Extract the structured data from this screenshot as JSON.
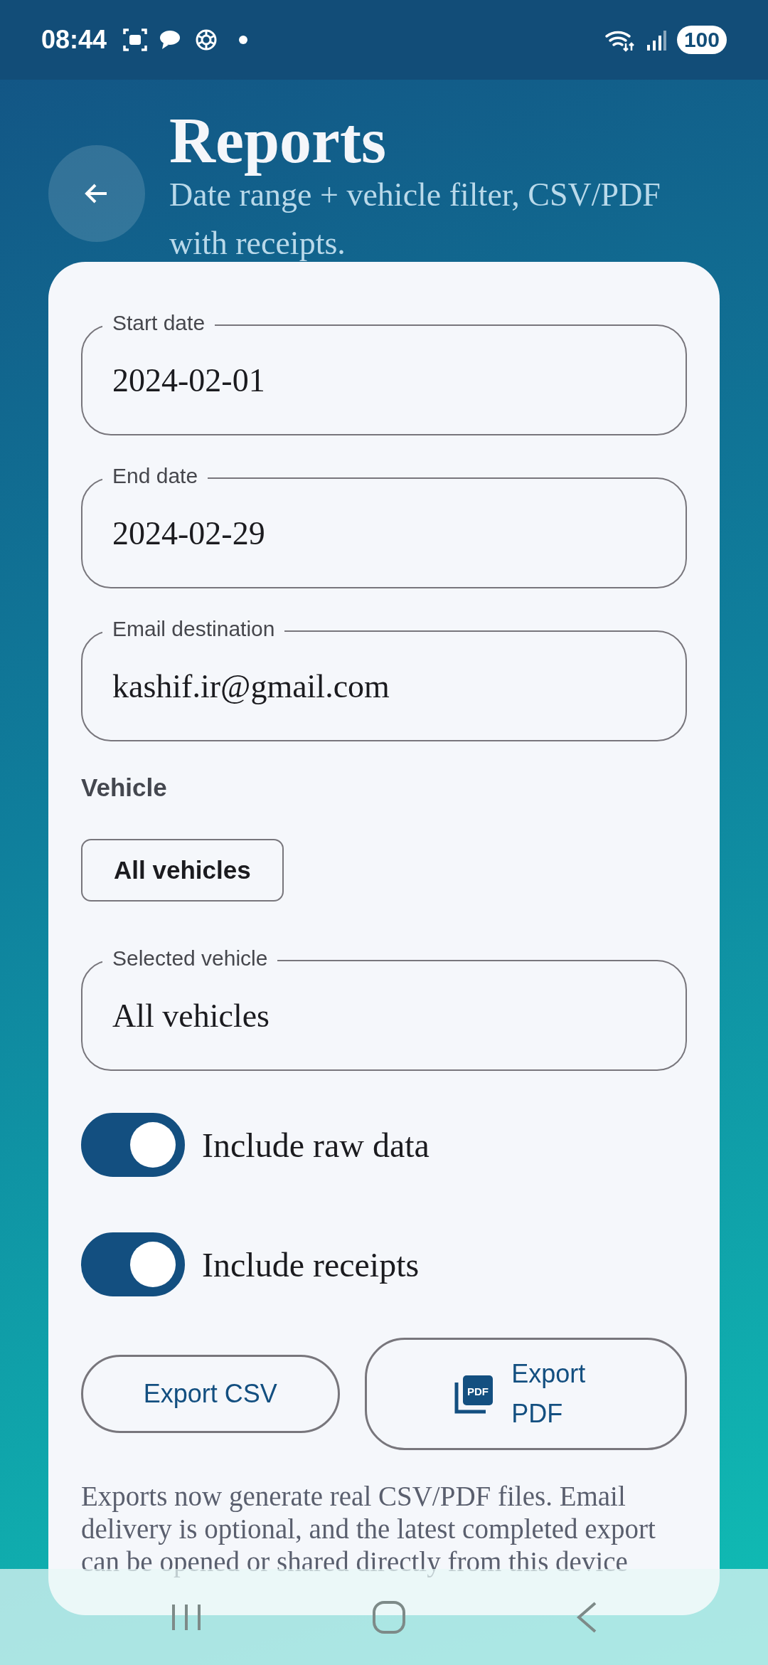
{
  "status_bar": {
    "time": "08:44",
    "battery": "100"
  },
  "header": {
    "title": "Reports",
    "subtitle": "Date range + vehicle filter, CSV/PDF with receipts."
  },
  "fields": [
    {
      "label": "Start date",
      "value": "2024-02-01"
    },
    {
      "label": "End date",
      "value": "2024-02-29"
    },
    {
      "label": "Email destination",
      "value": "kashif.ir@gmail.com"
    }
  ],
  "vehicle": {
    "heading": "Vehicle",
    "chips": [
      {
        "label": "All vehicles",
        "selected": false
      }
    ],
    "selected_field": {
      "label": "Selected vehicle",
      "value": "All vehicles"
    }
  },
  "toggles": [
    {
      "label": "Include raw data",
      "on": true
    },
    {
      "label": "Include receipts",
      "on": true
    }
  ],
  "buttons": [
    {
      "kind": "text",
      "label": "Export CSV"
    },
    {
      "kind": "pdf",
      "label": "Export PDF",
      "icon_text": "PDF"
    }
  ],
  "note": "Exports now generate real CSV/PDF files. Email delivery is optional, and the latest completed export can be opened or shared directly from this device"
}
